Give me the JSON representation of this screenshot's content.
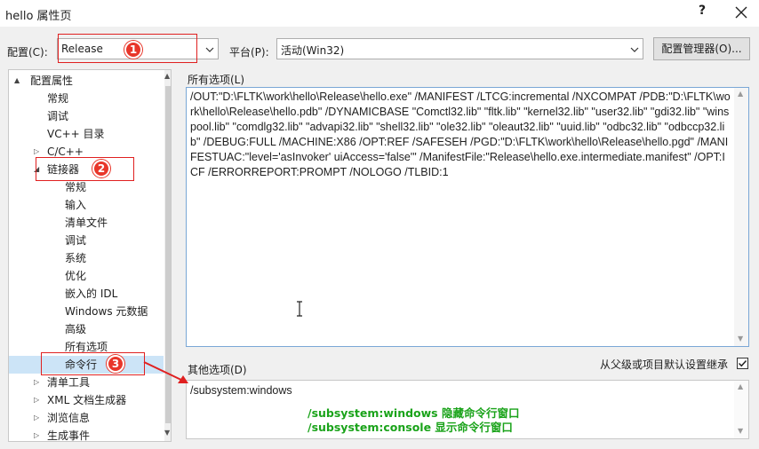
{
  "window": {
    "title": "hello 属性页",
    "help_glyph": "?"
  },
  "config": {
    "label": "配置(C):",
    "value": "Release"
  },
  "platform": {
    "label": "平台(P):",
    "value": "活动(Win32)"
  },
  "config_manager_button": "配置管理器(O)...",
  "tree": {
    "items": [
      {
        "label": "配置属性",
        "expander": "▲"
      },
      {
        "label": "常规"
      },
      {
        "label": "调试"
      },
      {
        "label": "VC++ 目录"
      },
      {
        "label": "C/C++",
        "expander": "▷"
      },
      {
        "label": "链接器",
        "expander": "◢"
      },
      {
        "label": "常规"
      },
      {
        "label": "输入"
      },
      {
        "label": "清单文件"
      },
      {
        "label": "调试"
      },
      {
        "label": "系统"
      },
      {
        "label": "优化"
      },
      {
        "label": "嵌入的 IDL"
      },
      {
        "label": "Windows 元数据"
      },
      {
        "label": "高级"
      },
      {
        "label": "所有选项"
      },
      {
        "label": "命令行"
      },
      {
        "label": "清单工具",
        "expander": "▷"
      },
      {
        "label": "XML 文档生成器",
        "expander": "▷"
      },
      {
        "label": "浏览信息",
        "expander": "▷"
      },
      {
        "label": "生成事件",
        "expander": "▷"
      }
    ]
  },
  "all_options": {
    "label": "所有选项(L)",
    "text": "/OUT:\"D:\\FLTK\\work\\hello\\Release\\hello.exe\" /MANIFEST /LTCG:incremental /NXCOMPAT /PDB:\"D:\\FLTK\\work\\hello\\Release\\hello.pdb\" /DYNAMICBASE \"Comctl32.lib\" \"fltk.lib\" \"kernel32.lib\" \"user32.lib\" \"gdi32.lib\" \"winspool.lib\" \"comdlg32.lib\" \"advapi32.lib\" \"shell32.lib\" \"ole32.lib\" \"oleaut32.lib\" \"uuid.lib\" \"odbc32.lib\" \"odbccp32.lib\" /DEBUG:FULL /MACHINE:X86 /OPT:REF /SAFESEH /PGD:\"D:\\FLTK\\work\\hello\\Release\\hello.pgd\" /MANIFESTUAC:\"level='asInvoker' uiAccess='false'\" /ManifestFile:\"Release\\hello.exe.intermediate.manifest\" /OPT:ICF /ERRORREPORT:PROMPT /NOLOGO /TLBID:1"
  },
  "other_options": {
    "label": "其他选项(D)",
    "value": "/subsystem:windows",
    "inherit_label": "从父级或项目默认设置继承",
    "inherit_checked": true
  },
  "annotations": {
    "badges": [
      "1",
      "2",
      "3"
    ],
    "note_windows": "/subsystem:windows 隐藏命令行窗口",
    "note_console": "/subsystem:console 显示命令行窗口",
    "color_red": "#e02020",
    "color_green": "#1aa31a"
  }
}
